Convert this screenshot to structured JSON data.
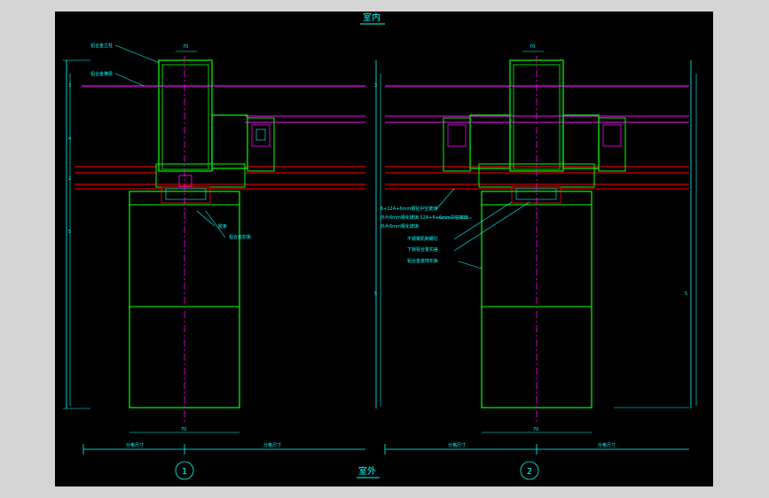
{
  "drawing": {
    "top_label": "室内",
    "bottom_label": "室外",
    "detail_1_number": "1",
    "detail_2_number": "2",
    "dim_small_top_1": "70",
    "dim_small_top_2": "70",
    "dim_bottom_left_1": "分格尺寸",
    "dim_bottom_right_1": "分格尺寸",
    "dim_bottom_left_2": "分格尺寸",
    "dim_bottom_right_2": "分格尺寸",
    "dim_mid_1": "70",
    "dim_mid_2": "70",
    "callouts_left": [
      "铝合金立柱",
      "铝合金横梁",
      "胶条",
      "铝合金扣板"
    ],
    "callouts_right": [
      "6+12A+6mm钢化中空玻璃",
      "外片6mm钢化玻璃 12A+6+6mm中空玻璃",
      "外片6mm钢化玻璃",
      "不锈钢机制螺钉",
      "下锁铝合金扣盖",
      "铝合金装饰扣板"
    ]
  },
  "colors": {
    "frame": "#00ff00",
    "hidden": "#ff00ff",
    "glass": "#ff0000",
    "dimension": "#00ffff",
    "text": "#00ffff",
    "title": "#00ffff",
    "canvas": "#000000",
    "outer": "#d4d4d4"
  }
}
